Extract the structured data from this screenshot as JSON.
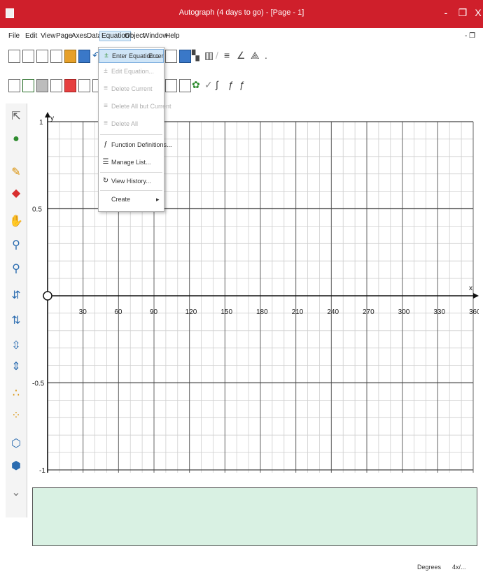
{
  "window": {
    "title": "Autograph (4 days to go) - [Page - 1]",
    "controls": [
      "-",
      "❐",
      "X"
    ]
  },
  "menubar": {
    "items": [
      "File",
      "Edit",
      "View",
      "Page",
      "Axes",
      "Data",
      "Equation",
      "Object",
      "Window",
      "Help"
    ],
    "active": "Equation",
    "right_restore": "- ❐"
  },
  "equation_menu": {
    "items": [
      {
        "label": "Enter Equation...",
        "shortcut": "Enter",
        "state": "highlight",
        "icon": "enter-equation-icon"
      },
      {
        "label": "Edit Equation...",
        "shortcut": "",
        "state": "disabled",
        "icon": "edit-equation-icon"
      },
      {
        "label": "Delete Current",
        "shortcut": "",
        "state": "disabled",
        "icon": "delete-current-icon"
      },
      {
        "label": "Delete All but Current",
        "shortcut": "",
        "state": "disabled",
        "icon": "delete-all-but-current-icon"
      },
      {
        "label": "Delete All",
        "shortcut": "",
        "state": "disabled",
        "icon": "delete-all-icon"
      },
      {
        "label": "Function Definitions...",
        "shortcut": "",
        "state": "normal",
        "icon": "function-definitions-icon"
      },
      {
        "label": "Manage List...",
        "shortcut": "",
        "state": "normal",
        "icon": "manage-list-icon"
      },
      {
        "label": "View History...",
        "shortcut": "",
        "state": "normal",
        "icon": "history-icon"
      },
      {
        "label": "Create",
        "shortcut": "▸",
        "state": "normal",
        "icon": ""
      }
    ]
  },
  "graph": {
    "y_axis_label": "y",
    "x_axis_label": "x",
    "y_ticks": [
      "1",
      "0.5",
      "-0.5",
      "-1"
    ],
    "x_ticks": [
      "30",
      "60",
      "90",
      "120",
      "150",
      "180",
      "210",
      "240",
      "270",
      "300",
      "330",
      "360"
    ],
    "origin_marker": "O"
  },
  "status": {
    "mode": "Degrees",
    "extra": "4x/..."
  },
  "colors": {
    "titlebar": "#cf1f2b",
    "bottom_panel": "#d9f1e3"
  }
}
